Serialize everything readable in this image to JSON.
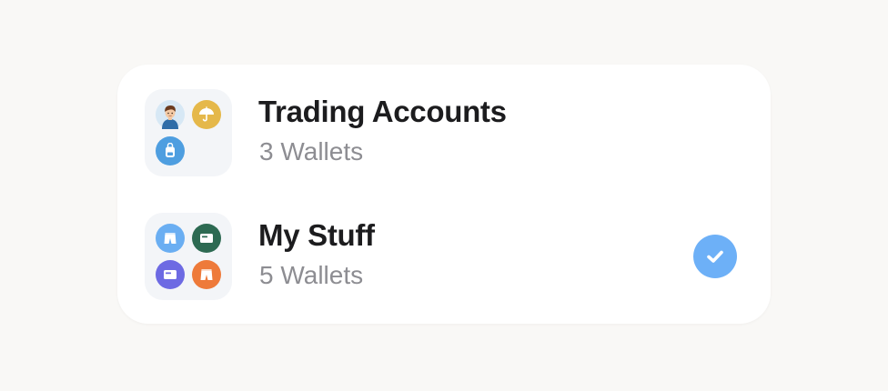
{
  "wallet_groups": [
    {
      "title": "Trading Accounts",
      "subtitle": "3 Wallets",
      "selected": false,
      "icons": [
        {
          "name": "person-avatar-icon",
          "color": "#d7e8f5"
        },
        {
          "name": "umbrella-icon",
          "color": "#e5b84a"
        },
        {
          "name": "backpack-icon",
          "color": "#4e9ee0"
        }
      ]
    },
    {
      "title": "My Stuff",
      "subtitle": "5 Wallets",
      "selected": true,
      "icons": [
        {
          "name": "shorts-icon",
          "color": "#6aaef2"
        },
        {
          "name": "wallet-icon",
          "color": "#2d6a52"
        },
        {
          "name": "wallet-icon",
          "color": "#6d6ae3"
        },
        {
          "name": "shorts-icon",
          "color": "#ee7a3a"
        }
      ]
    }
  ],
  "colors": {
    "background": "#f9f8f6",
    "card": "#ffffff",
    "tile": "#f3f5f8",
    "check": "#6db0f7",
    "title_text": "#1c1c1e",
    "subtitle_text": "#8d8d92"
  }
}
